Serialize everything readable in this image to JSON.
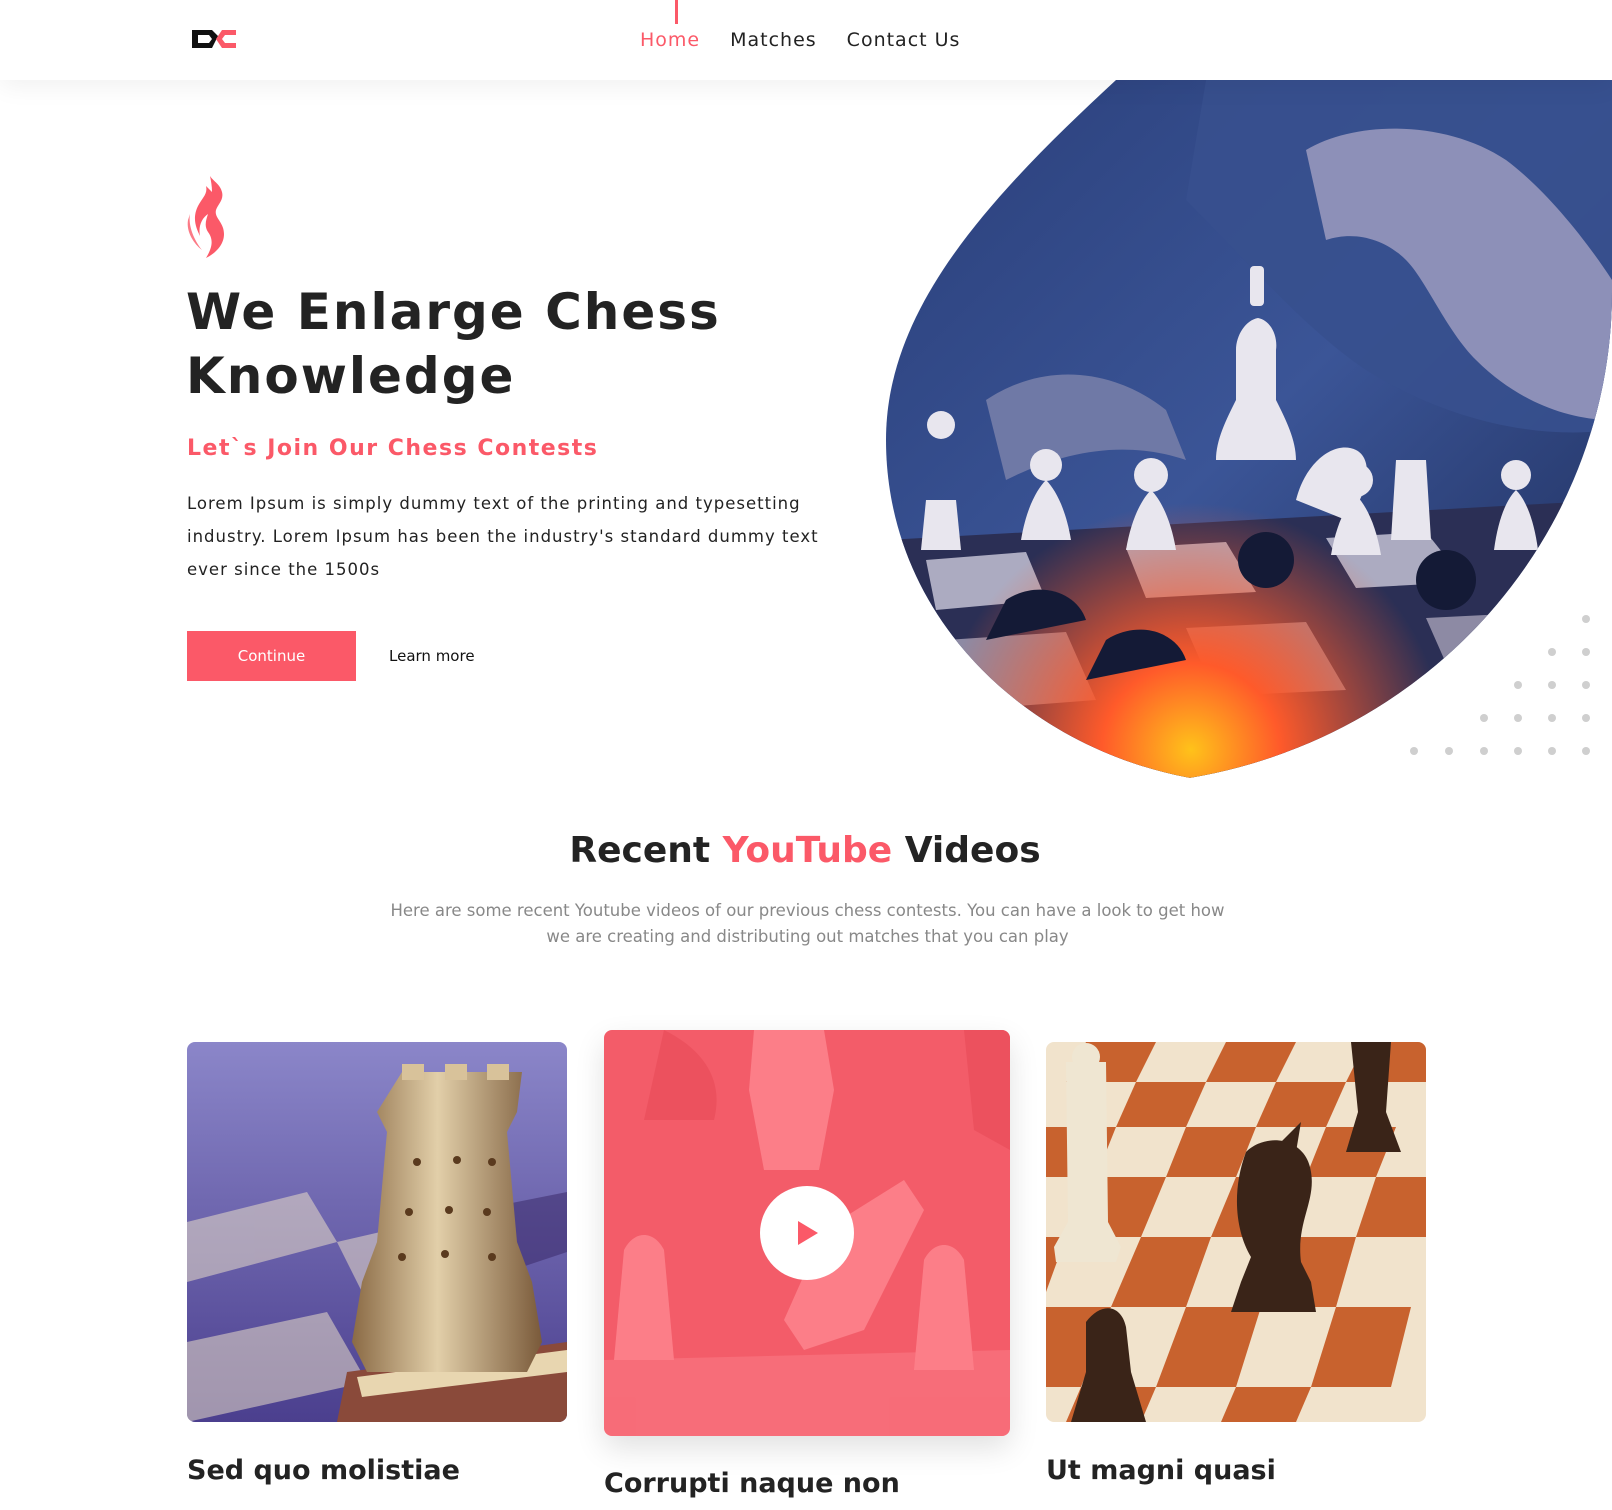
{
  "header": {
    "logo_name": "logo-icon",
    "nav": [
      {
        "label": "Home",
        "active": true
      },
      {
        "label": "Matches",
        "active": false
      },
      {
        "label": "Contact Us",
        "active": false
      }
    ]
  },
  "hero": {
    "icon_name": "knight-flame-icon",
    "title": "We Enlarge Chess Knowledge",
    "subtitle": "Let`s Join Our Chess Contests",
    "description": "Lorem Ipsum is simply dummy text of the printing and typesetting industry. Lorem Ipsum has been the industry's standard dummy text ever since the 1500s",
    "continue_label": "Continue",
    "learn_more_label": "Learn more"
  },
  "videos": {
    "title_prefix": "Recent ",
    "title_accent": "YouTube",
    "title_suffix": " Videos",
    "description": "Here are some recent Youtube videos of our previous chess contests. You can have a look to get how we are creating and distributing out matches that you can play",
    "cards": [
      {
        "title": "Sed quo molistiae"
      },
      {
        "title": "Corrupti naque non"
      },
      {
        "title": "Ut magni quasi"
      }
    ]
  },
  "colors": {
    "accent": "#fb5968",
    "text": "#232323",
    "muted": "#888888"
  }
}
